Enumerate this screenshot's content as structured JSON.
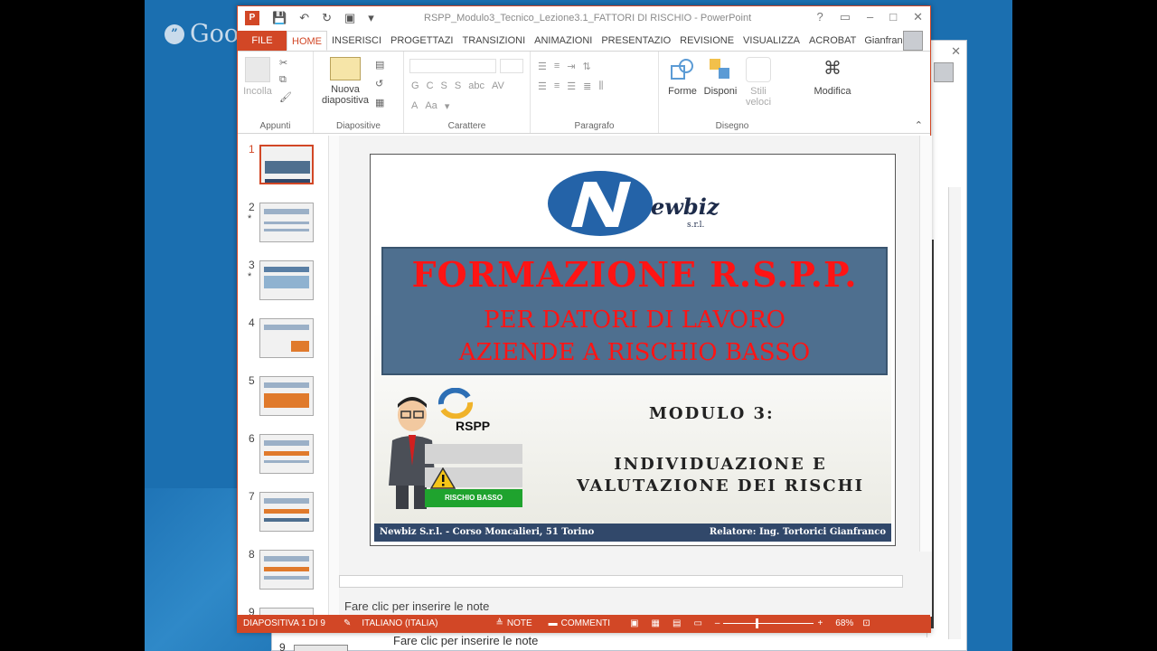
{
  "overlay": {
    "brand": "Google+"
  },
  "window": {
    "title": "RSPP_Modulo3_Tecnico_Lezione3.1_FATTORI DI RISCHIO - PowerPoint",
    "controls": [
      "?",
      "▭",
      "–",
      "□",
      "✕"
    ]
  },
  "tabs": {
    "file": "FILE",
    "items": [
      "HOME",
      "INSERISCI",
      "PROGETTAZI",
      "TRANSIZIONI",
      "ANIMAZIONI",
      "PRESENTAZIO",
      "REVISIONE",
      "VISUALIZZA",
      "ACROBAT"
    ],
    "active": "HOME",
    "user": "Gianfranc..."
  },
  "ribbon": {
    "groups": {
      "appunti": "Appunti",
      "diapositive": "Diapositive",
      "carattere": "Carattere",
      "paragrafo": "Paragrafo",
      "disegno": "Disegno"
    },
    "paste": "Incolla",
    "new_slide_1": "Nuova",
    "new_slide_2": "diapositiva",
    "shapes": "Forme",
    "arrange": "Disponi",
    "styles_1": "Stili",
    "styles_2": "veloci",
    "edit": "Modifica",
    "font_btns": [
      "G",
      "C",
      "S",
      "S",
      "abc",
      "AV"
    ]
  },
  "slides": {
    "numbers": [
      "1",
      "2",
      "3",
      "4",
      "5",
      "6",
      "7",
      "8",
      "9"
    ],
    "selected": "1"
  },
  "slide": {
    "logo_text": "ewbiz",
    "logo_sub": "s.r.l.",
    "line1": "FORMAZIONE R.S.P.P.",
    "line2": "PER DATORI DI LAVORO",
    "line3": "AZIENDE A RISCHIO BASSO",
    "rspp": "RSPP",
    "risk": "RISCHIO BASSO",
    "module": "MODULO 3:",
    "topic1": "INDIVIDUAZIONE E",
    "topic2": "VALUTAZIONE DEI RISCHI",
    "footer_left": "Newbiz S.r.l. - Corso Moncalieri, 51 Torino",
    "footer_right": "Relatore: Ing. Tortorici Gianfranco"
  },
  "notes_placeholder": "Fare clic per inserire le note",
  "status": {
    "slide": "DIAPOSITIVA 1 DI 9",
    "language": "ITALIANO (ITALIA)",
    "notes": "NOTE",
    "comments": "COMMENTI",
    "zoom": "68%"
  },
  "background_window": {
    "notes_placeholder": "Fare clic per inserire le note",
    "slide_num": "9"
  },
  "colors": {
    "accent": "#d24726",
    "banner": "#4e6f8f",
    "title_red": "#ff1414",
    "footer": "#31486a"
  }
}
